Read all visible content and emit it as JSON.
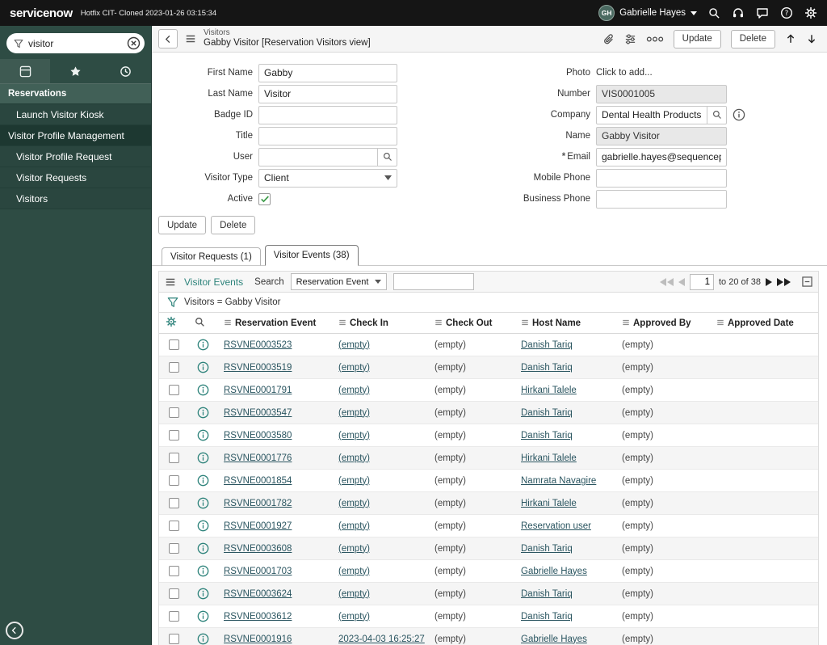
{
  "colors": {
    "accent": "#2e837b",
    "topbar_bg": "#151515",
    "sidebar_bg": "#2e4c44",
    "link": "#2a5560"
  },
  "icons": {
    "search": "magnifier",
    "filter": "funnel",
    "menu": "hamburger",
    "attachment": "paperclip",
    "personalize": "sliders",
    "more": "three-circles",
    "info": "circle-i",
    "settings": "gear",
    "help": "question-circle",
    "chat": "speech-bubble",
    "presence": "headset",
    "favorites": "star",
    "history": "clock",
    "apps": "grid",
    "collapse_list": "minus-square"
  },
  "topbar": {
    "logo": "servicenow",
    "instance": "Hotfix CIT- Cloned 2023-01-26 03:15:34",
    "user": {
      "initials": "GH",
      "name": "Gabrielle Hayes"
    }
  },
  "sidebar": {
    "search": {
      "value": "visitor"
    },
    "items": [
      {
        "label": "Reservations",
        "kind": "app"
      },
      {
        "label": "Launch Visitor Kiosk",
        "kind": "module"
      },
      {
        "label": "Visitor Profile Management",
        "kind": "section"
      },
      {
        "label": "Visitor Profile Request",
        "kind": "module"
      },
      {
        "label": "Visitor Requests",
        "kind": "module"
      },
      {
        "label": "Visitors",
        "kind": "module"
      }
    ]
  },
  "ribbon": {
    "breadcrumb": "Visitors",
    "title": "Gabby Visitor [Reservation Visitors view]",
    "buttons": {
      "update": "Update",
      "delete": "Delete"
    }
  },
  "form": {
    "left": [
      {
        "label": "First Name",
        "value": "Gabby"
      },
      {
        "label": "Last Name",
        "value": "Visitor"
      },
      {
        "label": "Badge ID",
        "value": ""
      },
      {
        "label": "Title",
        "value": ""
      },
      {
        "label": "User",
        "value": ""
      },
      {
        "label": "Visitor Type",
        "value": "Client"
      },
      {
        "label": "Active",
        "checked": true
      }
    ],
    "right": [
      {
        "label": "Photo",
        "value": "Click to add..."
      },
      {
        "label": "Number",
        "value": "VIS0001005"
      },
      {
        "label": "Company",
        "value": "Dental Health Products Inc"
      },
      {
        "label": "Name",
        "value": "Gabby Visitor"
      },
      {
        "label": "Email",
        "value": "gabrielle.hayes@sequencepartners.consu",
        "required": "*"
      },
      {
        "label": "Mobile Phone",
        "value": ""
      },
      {
        "label": "Business Phone",
        "value": ""
      }
    ],
    "actions": {
      "update": "Update",
      "delete": "Delete"
    }
  },
  "tabs": [
    {
      "label": "Visitor Requests (1)",
      "active": false
    },
    {
      "label": "Visitor Events (38)",
      "active": true
    }
  ],
  "list": {
    "title": "Visitor Events",
    "search_label": "Search",
    "search_column": "Reservation Event",
    "pagination": {
      "page": "1",
      "range_label": "to 20 of 38"
    },
    "filter_text": "Visitors = Gabby Visitor",
    "columns": [
      "Reservation Event",
      "Check In",
      "Check Out",
      "Host Name",
      "Approved By",
      "Approved Date"
    ],
    "rows": [
      {
        "event": "RSVNE0003523",
        "check_in": "(empty)",
        "check_out": "(empty)",
        "host": "Danish Tariq",
        "approved_by": "(empty)",
        "approved_date": ""
      },
      {
        "event": "RSVNE0003519",
        "check_in": "(empty)",
        "check_out": "(empty)",
        "host": "Danish Tariq",
        "approved_by": "(empty)",
        "approved_date": ""
      },
      {
        "event": "RSVNE0001791",
        "check_in": "(empty)",
        "check_out": "(empty)",
        "host": "Hirkani Talele",
        "approved_by": "(empty)",
        "approved_date": ""
      },
      {
        "event": "RSVNE0003547",
        "check_in": "(empty)",
        "check_out": "(empty)",
        "host": "Danish Tariq",
        "approved_by": "(empty)",
        "approved_date": ""
      },
      {
        "event": "RSVNE0003580",
        "check_in": "(empty)",
        "check_out": "(empty)",
        "host": "Danish Tariq",
        "approved_by": "(empty)",
        "approved_date": ""
      },
      {
        "event": "RSVNE0001776",
        "check_in": "(empty)",
        "check_out": "(empty)",
        "host": "Hirkani Talele",
        "approved_by": "(empty)",
        "approved_date": ""
      },
      {
        "event": "RSVNE0001854",
        "check_in": "(empty)",
        "check_out": "(empty)",
        "host": "Namrata Navagire",
        "approved_by": "(empty)",
        "approved_date": ""
      },
      {
        "event": "RSVNE0001782",
        "check_in": "(empty)",
        "check_out": "(empty)",
        "host": "Hirkani Talele",
        "approved_by": "(empty)",
        "approved_date": ""
      },
      {
        "event": "RSVNE0001927",
        "check_in": "(empty)",
        "check_out": "(empty)",
        "host": "Reservation user",
        "approved_by": "(empty)",
        "approved_date": ""
      },
      {
        "event": "RSVNE0003608",
        "check_in": "(empty)",
        "check_out": "(empty)",
        "host": "Danish Tariq",
        "approved_by": "(empty)",
        "approved_date": ""
      },
      {
        "event": "RSVNE0001703",
        "check_in": "(empty)",
        "check_out": "(empty)",
        "host": "Gabrielle Hayes",
        "approved_by": "(empty)",
        "approved_date": ""
      },
      {
        "event": "RSVNE0003624",
        "check_in": "(empty)",
        "check_out": "(empty)",
        "host": "Danish Tariq",
        "approved_by": "(empty)",
        "approved_date": ""
      },
      {
        "event": "RSVNE0003612",
        "check_in": "(empty)",
        "check_out": "(empty)",
        "host": "Danish Tariq",
        "approved_by": "(empty)",
        "approved_date": ""
      },
      {
        "event": "RSVNE0001916",
        "check_in": "2023-04-03 16:25:27",
        "check_out": "(empty)",
        "host": "Gabrielle Hayes",
        "approved_by": "(empty)",
        "approved_date": ""
      }
    ]
  }
}
